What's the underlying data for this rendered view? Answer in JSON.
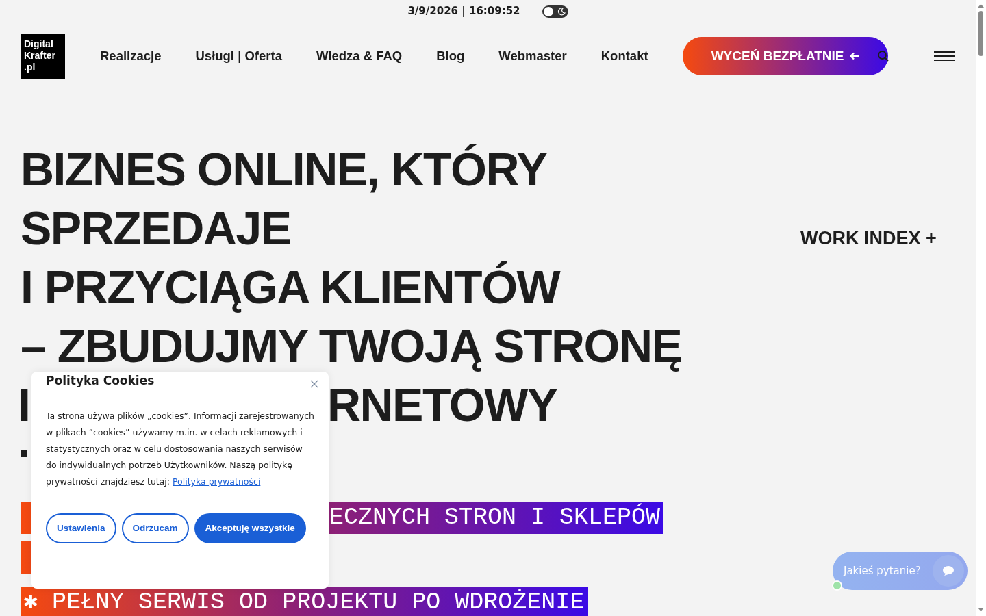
{
  "top_bar": {
    "datetime": "3/9/2026 | 16:09:52",
    "dark_mode": false
  },
  "header": {
    "logo_lines": [
      "Digital",
      "Krafter",
      ".pl"
    ],
    "nav": [
      "Realizacje",
      "Usługi | Oferta",
      "Wiedza & FAQ",
      "Blog",
      "Webmaster",
      "Kontakt"
    ],
    "cta": "WYCEŃ BEZPŁATNIE"
  },
  "hero": {
    "heading_lines": [
      [
        "BIZNES ONLINE, KTÓRY"
      ],
      [
        "SPRZEDAJE"
      ],
      [
        "I PRZYCIĄGA KLIENTÓW"
      ],
      [
        "– ZBUDUJMY TWOJĄ STRONĘ"
      ],
      [
        "I",
        "RNETOWY"
      ]
    ],
    "highlights": [
      {
        "kind": "text",
        "text": "ECZNYCH STRON I SKLEPÓW"
      },
      {
        "kind": "bare"
      },
      {
        "kind": "text",
        "text": "✱ PEŁNY SERWIS OD PROJEKTU PO WDROŻENIE"
      }
    ],
    "work_index": "WORK INDEX +"
  },
  "cookie_dialog": {
    "title": "Polityka Cookies",
    "body": "Ta strona używa plików „cookies”. Informacji zarejestrowanych w plikach ”cookies” używamy m.in. w celach reklamowych i statystycznych oraz w celu dostosowania naszych serwisów do indywidualnych potrzeb Użytkowników. Naszą politykę prywatności znajdziesz tutaj:",
    "link": "Polityka prywatności",
    "buttons": [
      {
        "label": "Ustawienia",
        "primary": false
      },
      {
        "label": "Odrzucam",
        "primary": false
      },
      {
        "label": "Akceptuję wszystkie",
        "primary": true
      }
    ]
  },
  "chat": {
    "label": "Jakieś pytanie?",
    "online": true
  }
}
